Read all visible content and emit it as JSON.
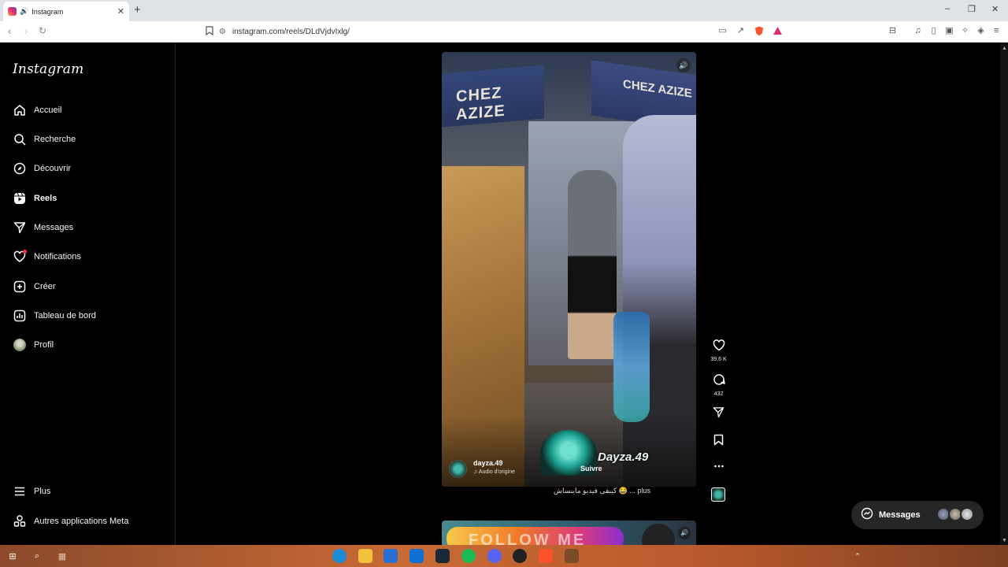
{
  "browser": {
    "tab_title": "Instagram",
    "new_tab_symbol": "+",
    "url": "instagram.com/reels/DLdVjdvIxlg/",
    "window_controls": [
      "–",
      "❐",
      "✕"
    ]
  },
  "sidebar": {
    "logo": "Instagram",
    "items": [
      {
        "label": "Accueil",
        "icon": "home-icon"
      },
      {
        "label": "Recherche",
        "icon": "search-icon"
      },
      {
        "label": "Découvrir",
        "icon": "compass-icon"
      },
      {
        "label": "Reels",
        "icon": "reels-icon",
        "active": true
      },
      {
        "label": "Messages",
        "icon": "send-icon"
      },
      {
        "label": "Notifications",
        "icon": "heart-icon",
        "badge": true
      },
      {
        "label": "Créer",
        "icon": "plus-square-icon"
      },
      {
        "label": "Tableau de bord",
        "icon": "chart-icon"
      },
      {
        "label": "Profil",
        "icon": "avatar"
      }
    ],
    "bottom": [
      {
        "label": "Plus",
        "icon": "menu-icon"
      },
      {
        "label": "Autres applications Meta",
        "icon": "meta-apps-icon"
      }
    ]
  },
  "reel": {
    "sign_left": "CHEZ AZIZE",
    "sign_right": "CHEZ AZIZE",
    "author": "dayza.49",
    "audio": "♫ Audio d'origine",
    "follow": "Suivre",
    "watermark": "Dayza.49",
    "caption": "كيبقى فيديو ماينساش 😂 ... plus",
    "likes": "39,6 K",
    "comments": "432"
  },
  "next_reel": {
    "banner": "FOLLOW ME"
  },
  "messages_pill": {
    "label": "Messages"
  },
  "colors": {
    "accent": "#ff3040",
    "background": "#000000",
    "pill": "#262626"
  }
}
